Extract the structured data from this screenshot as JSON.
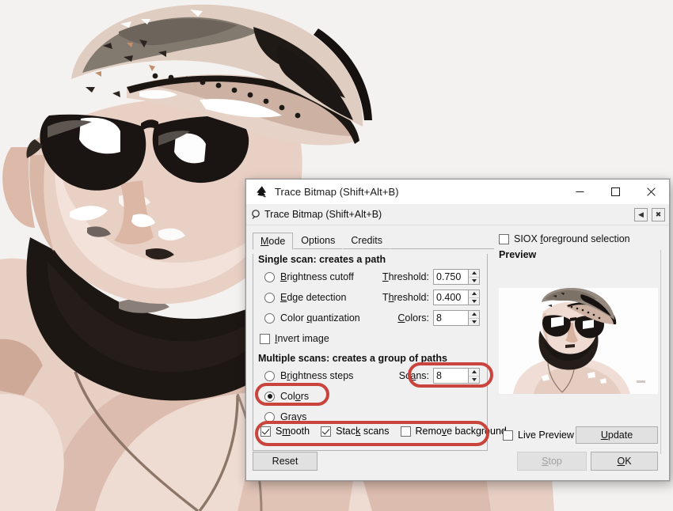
{
  "window": {
    "title": "Trace Bitmap (Shift+Alt+B)",
    "icon": "inkscape-logo-icon",
    "minimize_label": "—",
    "maximize_label": "□",
    "close_label": "✕"
  },
  "dock": {
    "title": "Trace Bitmap (Shift+Alt+B)",
    "icon": "trace-bitmap-icon",
    "collapse_label": "◀",
    "close_label": "✖"
  },
  "tabs": [
    {
      "label": "Mode",
      "accel": "M",
      "active": true
    },
    {
      "label": "Options",
      "accel": "O",
      "active": false
    },
    {
      "label": "Credits",
      "accel": "C",
      "active": false
    }
  ],
  "single_scan": {
    "group_label": "Single scan: creates a path",
    "options": [
      {
        "label": "Brightness cutoff",
        "accel": "B",
        "checked": false,
        "field_label": "Threshold:",
        "field_accel": "T",
        "value": "0.750"
      },
      {
        "label": "Edge detection",
        "accel": "E",
        "checked": false,
        "field_label": "Threshold:",
        "field_accel": "h",
        "value": "0.400"
      },
      {
        "label": "Color quantization",
        "accel": "q",
        "checked": false,
        "field_label": "Colors:",
        "field_accel": "C",
        "value": "8"
      }
    ],
    "invert": {
      "label": "Invert image",
      "accel": "I",
      "checked": false
    }
  },
  "multiple_scans": {
    "group_label": "Multiple scans: creates a group of paths",
    "options": [
      {
        "label": "Brightness steps",
        "accel": "r",
        "checked": false,
        "field_label": "Scans:",
        "field_accel": "a",
        "value": "8"
      },
      {
        "label": "Colors",
        "accel": "o",
        "checked": true
      },
      {
        "label": "Grays",
        "accel": "G",
        "checked": false
      }
    ],
    "checks": [
      {
        "label": "Smooth",
        "accel": "m",
        "checked": true
      },
      {
        "label": "Stack scans",
        "accel": "k",
        "checked": true
      },
      {
        "label": "Remove background",
        "accel": "v",
        "checked": false
      }
    ]
  },
  "right_pane": {
    "siox": {
      "label": "SIOX foreground selection",
      "accel": "f",
      "checked": false
    },
    "preview_label": "Preview",
    "live_preview": {
      "label": "Live Preview",
      "checked": false
    },
    "update_button": {
      "label": "Update",
      "accel": "U"
    }
  },
  "footer": {
    "reset_button": {
      "label": "Reset"
    },
    "stop_button": {
      "label": "Stop",
      "accel": "S",
      "disabled": true
    },
    "ok_button": {
      "label": "OK",
      "accel": "O"
    }
  },
  "annotations": {
    "color": "#c8443c",
    "highlights": [
      "scans-field",
      "colors-radio",
      "smooth-stack-remove-checkbox-row"
    ]
  },
  "background": {
    "description": "Posterized vector-traced portrait of a bearded man wearing a backwards cap and sunglasses",
    "palette": [
      "#f4f2f0",
      "#e6d6cd",
      "#d8bcae",
      "#c4a091",
      "#9a8279",
      "#6f6763",
      "#2b2522",
      "#ffffff"
    ]
  },
  "preview_image": {
    "description": "Traced color preview thumbnail of the same portrait on white background"
  }
}
